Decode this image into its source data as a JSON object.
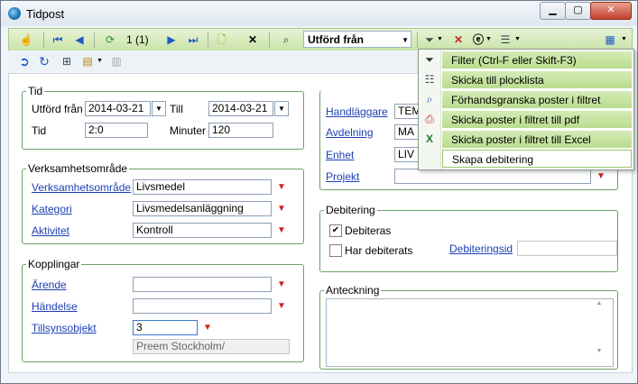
{
  "window": {
    "title": "Tidpost"
  },
  "toolbar": {
    "record_counter": "1 (1)",
    "field_combo": "Utförd från"
  },
  "tid": {
    "legend": "Tid",
    "utford_fran_label": "Utförd från",
    "utford_fran_value": "2014-03-21",
    "till_label": "Till",
    "till_value": "2014-03-21",
    "tid_label": "Tid",
    "tid_value": "2:0",
    "minuter_label": "Minuter",
    "minuter_value": "120"
  },
  "verksamhet": {
    "legend": "Verksamhetsområde",
    "omrade_label": "Verksamhetsområde",
    "omrade_value": "Livsmedel",
    "kategori_label": "Kategori",
    "kategori_value": "Livsmedelsanläggning",
    "aktivitet_label": "Aktivitet",
    "aktivitet_value": "Kontroll"
  },
  "kopplingar": {
    "legend": "Kopplingar",
    "arende_label": "Ärende",
    "arende_value": "",
    "handelse_label": "Händelse",
    "handelse_value": "",
    "tillsyn_label": "Tillsynsobjekt",
    "tillsyn_value": "3",
    "tillsyn_name": "Preem Stockholm/"
  },
  "handlaggning": {
    "handlaggare_label": "Handläggare",
    "handlaggare_value": "TEM",
    "avdelning_label": "Avdelning",
    "avdelning_value": "MA",
    "enhet_label": "Enhet",
    "enhet_value": "LIV",
    "projekt_label": "Projekt",
    "projekt_value": ""
  },
  "debitering": {
    "legend": "Debitering",
    "debiteras_label": "Debiteras",
    "debiteras_checked": "✔",
    "har_debiterats_label": "Har debiterats",
    "debiteringsid_label": "Debiteringsid",
    "debiteringsid_value": ""
  },
  "anteckning": {
    "legend": "Anteckning",
    "value": ""
  },
  "menu": {
    "items": [
      {
        "label": "Filter (Ctrl-F eller Skift-F3)",
        "icon": "filter-icon"
      },
      {
        "label": "Skicka till plocklista",
        "icon": "list-icon"
      },
      {
        "label": "Förhandsgranska poster i filtret",
        "icon": "preview-icon"
      },
      {
        "label": "Skicka poster i filtret till pdf",
        "icon": "pdf-icon"
      },
      {
        "label": "Skicka poster i filtret till Excel",
        "icon": "excel-icon"
      },
      {
        "label": "Skapa debitering",
        "icon": ""
      }
    ]
  },
  "colors": {
    "toolbar_green": "#c9e3a7",
    "link_blue": "#1c3fb4",
    "group_border": "#6aa06a",
    "red_arrow": "#d01f1f"
  }
}
